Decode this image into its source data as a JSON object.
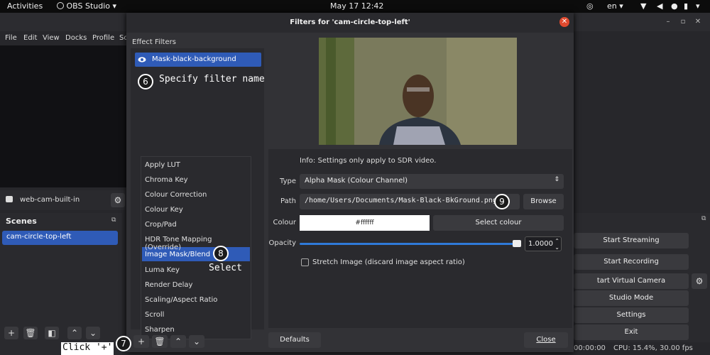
{
  "topbar": {
    "activities": "Activities",
    "app_name": "OBS Studio",
    "clock": "May 17  12:42",
    "language": "en"
  },
  "obs": {
    "menu": [
      "File",
      "Edit",
      "View",
      "Docks",
      "Profile",
      "Sc"
    ],
    "source_name": "web-cam-built-in",
    "scenes_title": "Scenes",
    "scene_item": "cam-circle-top-left",
    "controls": [
      "Start Streaming",
      "Start Recording",
      "tart Virtual Camera",
      "Studio Mode",
      "Settings",
      "Exit"
    ],
    "status_time": "00:00:00",
    "status_cpu": "CPU: 15.4%, 30.00 fps"
  },
  "dialog": {
    "title": "Filters for 'cam-circle-top-left'",
    "effect_filters_label": "Effect Filters",
    "effect_item": "Mask-black-background",
    "menu_items": [
      "Apply LUT",
      "Chroma Key",
      "Colour Correction",
      "Colour Key",
      "Crop/Pad",
      "HDR Tone Mapping (Override)",
      "Image Mask/Blend",
      "Luma Key",
      "Render Delay",
      "Scaling/Aspect Ratio",
      "Scroll",
      "Sharpen"
    ],
    "info": "Info: Settings only apply to SDR video.",
    "type_label": "Type",
    "type_value": "Alpha Mask (Colour Channel)",
    "path_label": "Path",
    "path_value": "/home/Users/Documents/Mask-Black-BkGround.png",
    "browse": "Browse",
    "colour_label": "Colour",
    "colour_value": "#ffffff",
    "select_colour": "Select colour",
    "opacity_label": "Opacity",
    "opacity_value": "1.0000",
    "opacity_fraction": 1.0,
    "stretch_label": "Stretch Image (discard image aspect ratio)",
    "defaults": "Defaults",
    "close": "Close"
  },
  "annotations": {
    "n6": "6",
    "t6": "Specify filter name",
    "n7": "7",
    "t7": "Click '+'",
    "n8": "8",
    "t8": "Select",
    "n9": "9"
  },
  "colors": {
    "accent": "#2f5bb7",
    "slider": "#2f7ad8",
    "close": "#e04a2f"
  }
}
